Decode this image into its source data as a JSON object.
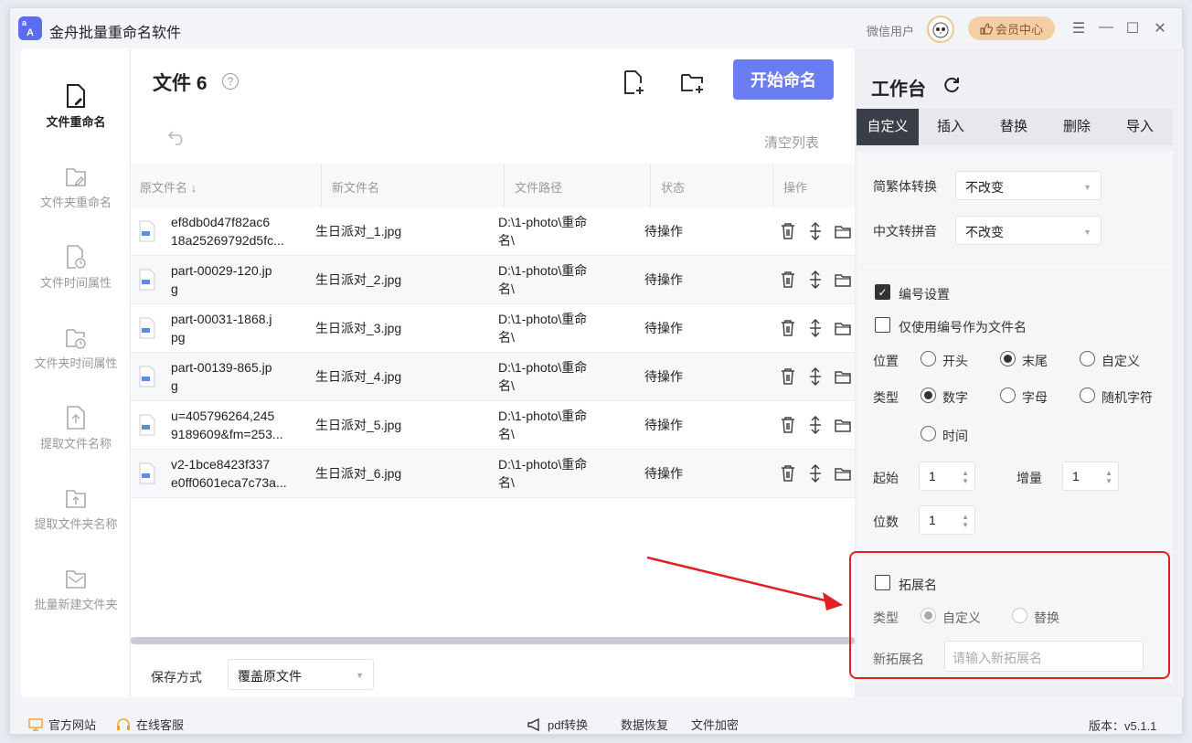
{
  "window": {
    "title": "金舟批量重命名软件",
    "logo_text": "A",
    "logo_small": "a"
  },
  "header": {
    "user_name": "微信用户",
    "vip_label": "会员中心"
  },
  "sidebar": {
    "items": [
      {
        "label": "文件重命名",
        "icon": "file-edit-icon"
      },
      {
        "label": "文件夹重命名",
        "icon": "folder-edit-icon"
      },
      {
        "label": "文件时间属性",
        "icon": "file-clock-icon"
      },
      {
        "label": "文件夹时间属性",
        "icon": "folder-clock-icon"
      },
      {
        "label": "提取文件名称",
        "icon": "file-upload-icon"
      },
      {
        "label": "提取文件夹名称",
        "icon": "folder-upload-icon"
      },
      {
        "label": "批量新建文件夹",
        "icon": "folder-mail-icon"
      }
    ]
  },
  "main": {
    "title": "文件 6",
    "help": "?",
    "start_button": "开始命名",
    "clear_list": "清空列表",
    "columns": [
      "原文件名",
      "新文件名",
      "文件路径",
      "状态",
      "操作"
    ],
    "rows": [
      {
        "orig1": "ef8db0d47f82ac6",
        "orig2": "18a25269792d5fc...",
        "new": "生日派对_1.jpg",
        "path1": "D:\\1-photo\\重命",
        "path2": "名\\",
        "status": "待操作"
      },
      {
        "orig1": "part-00029-120.jp",
        "orig2": "g",
        "new": "生日派对_2.jpg",
        "path1": "D:\\1-photo\\重命",
        "path2": "名\\",
        "status": "待操作"
      },
      {
        "orig1": "part-00031-1868.j",
        "orig2": "pg",
        "new": "生日派对_3.jpg",
        "path1": "D:\\1-photo\\重命",
        "path2": "名\\",
        "status": "待操作"
      },
      {
        "orig1": "part-00139-865.jp",
        "orig2": "g",
        "new": "生日派对_4.jpg",
        "path1": "D:\\1-photo\\重命",
        "path2": "名\\",
        "status": "待操作"
      },
      {
        "orig1": "u=405796264,245",
        "orig2": "9189609&fm=253...",
        "new": "生日派对_5.jpg",
        "path1": "D:\\1-photo\\重命",
        "path2": "名\\",
        "status": "待操作"
      },
      {
        "orig1": "v2-1bce8423f337",
        "orig2": "e0ff0601eca7c73a...",
        "new": "生日派对_6.jpg",
        "path1": "D:\\1-photo\\重命",
        "path2": "名\\",
        "status": "待操作"
      }
    ],
    "save_label": "保存方式",
    "save_value": "覆盖原文件"
  },
  "panel": {
    "title": "工作台",
    "tabs": [
      "自定义",
      "插入",
      "替换",
      "删除",
      "导入"
    ],
    "trad_label": "简繁体转换",
    "trad_value": "不改变",
    "pinyin_label": "中文转拼音",
    "pinyin_value": "不改变",
    "numbering_label": "编号设置",
    "only_number_label": "仅使用编号作为文件名",
    "position_label": "位置",
    "position_options": [
      "开头",
      "末尾",
      "自定义"
    ],
    "type_label": "类型",
    "type_options": [
      "数字",
      "字母",
      "随机字符",
      "时间"
    ],
    "start_label": "起始",
    "start_value": "1",
    "step_label": "增量",
    "step_value": "1",
    "digits_label": "位数",
    "digits_value": "1",
    "ext_label": "拓展名",
    "ext_type_label": "类型",
    "ext_type_options": [
      "自定义",
      "替换"
    ],
    "new_ext_label": "新拓展名",
    "new_ext_placeholder": "请输入新拓展名"
  },
  "footer": {
    "website": "官方网站",
    "support": "在线客服",
    "pdf": "pdf转换",
    "recover": "数据恢复",
    "encrypt": "文件加密",
    "version": "版本：v5.1.1"
  },
  "colors": {
    "accent": "#6a7cf2",
    "highlight": "#e02020",
    "vip": "#f4cfa6"
  }
}
